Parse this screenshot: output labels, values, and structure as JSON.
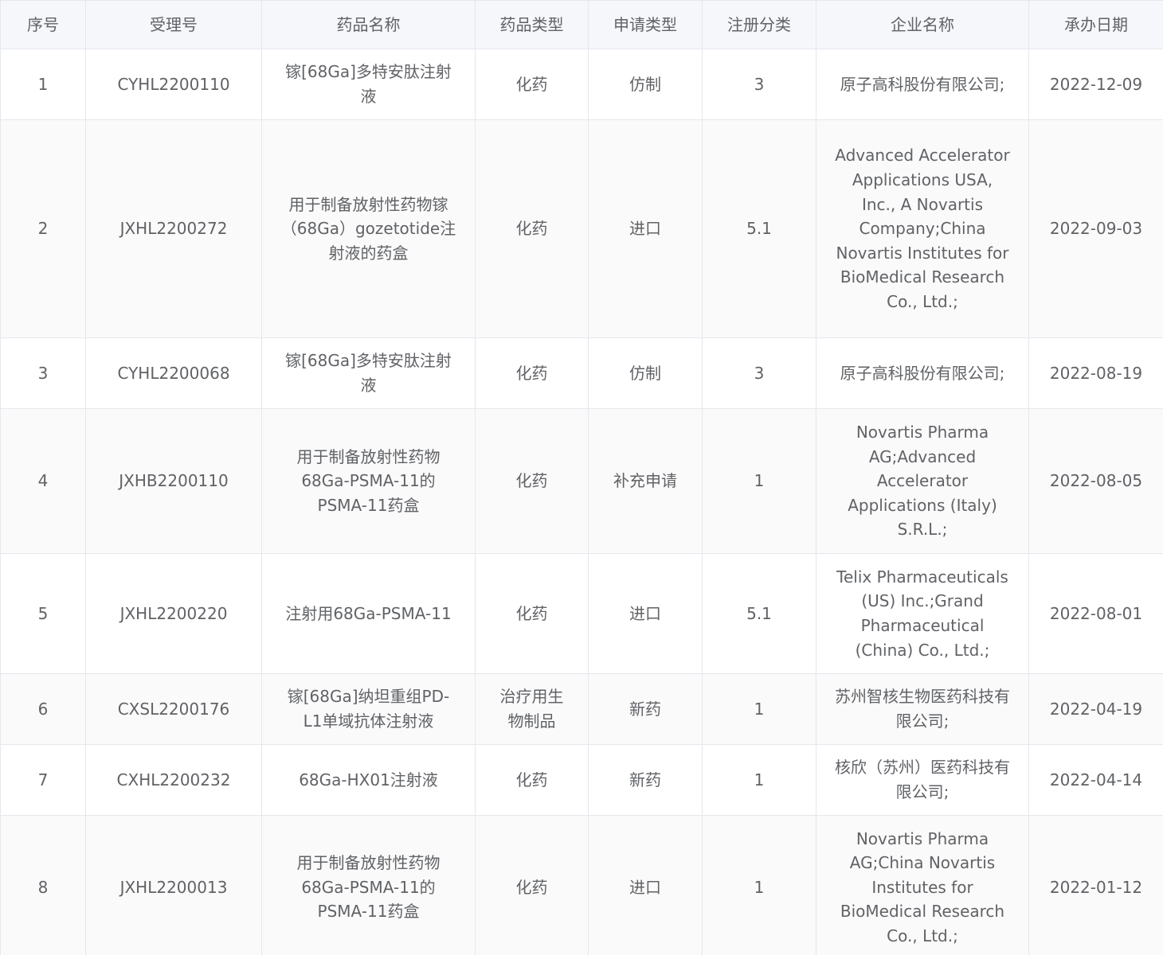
{
  "table": {
    "headers": [
      "序号",
      "受理号",
      "药品名称",
      "药品类型",
      "申请类型",
      "注册分类",
      "企业名称",
      "承办日期"
    ],
    "rows": [
      {
        "no": "1",
        "accept_no": "CYHL2200110",
        "drug_name": "镓[68Ga]多特安肽注射液",
        "drug_type": "化药",
        "app_type": "仿制",
        "reg_class": "3",
        "company": "原子高科股份有限公司;",
        "date": "2022-12-09"
      },
      {
        "no": "2",
        "accept_no": "JXHL2200272",
        "drug_name": "用于制备放射性药物镓（68Ga）gozetotide注射液的药盒",
        "drug_type": "化药",
        "app_type": "进口",
        "reg_class": "5.1",
        "company": "Advanced Accelerator Applications USA, Inc., A Novartis Company;China Novartis Institutes for BioMedical Research Co., Ltd.;",
        "date": "2022-09-03"
      },
      {
        "no": "3",
        "accept_no": "CYHL2200068",
        "drug_name": "镓[68Ga]多特安肽注射液",
        "drug_type": "化药",
        "app_type": "仿制",
        "reg_class": "3",
        "company": "原子高科股份有限公司;",
        "date": "2022-08-19"
      },
      {
        "no": "4",
        "accept_no": "JXHB2200110",
        "drug_name": "用于制备放射性药物68Ga-PSMA-11的PSMA-11药盒",
        "drug_type": "化药",
        "app_type": "补充申请",
        "reg_class": "1",
        "company": "Novartis Pharma AG;Advanced Accelerator Applications (Italy) S.R.L.;",
        "date": "2022-08-05"
      },
      {
        "no": "5",
        "accept_no": "JXHL2200220",
        "drug_name": "注射用68Ga-PSMA-11",
        "drug_type": "化药",
        "app_type": "进口",
        "reg_class": "5.1",
        "company": "Telix Pharmaceuticals (US) Inc.;Grand Pharmaceutical (China) Co., Ltd.;",
        "date": "2022-08-01"
      },
      {
        "no": "6",
        "accept_no": "CXSL2200176",
        "drug_name": "镓[68Ga]纳坦重组PD-L1单域抗体注射液",
        "drug_type": "治疗用生物制品",
        "app_type": "新药",
        "reg_class": "1",
        "company": "苏州智核生物医药科技有限公司;",
        "date": "2022-04-19"
      },
      {
        "no": "7",
        "accept_no": "CXHL2200232",
        "drug_name": "68Ga-HX01注射液",
        "drug_type": "化药",
        "app_type": "新药",
        "reg_class": "1",
        "company": "核欣（苏州）医药科技有限公司;",
        "date": "2022-04-14"
      },
      {
        "no": "8",
        "accept_no": "JXHL2200013",
        "drug_name": "用于制备放射性药物68Ga-PSMA-11的PSMA-11药盒",
        "drug_type": "化药",
        "app_type": "进口",
        "reg_class": "1",
        "company": "Novartis Pharma AG;China Novartis Institutes for BioMedical Research Co., Ltd.;",
        "date": "2022-01-12"
      }
    ]
  }
}
